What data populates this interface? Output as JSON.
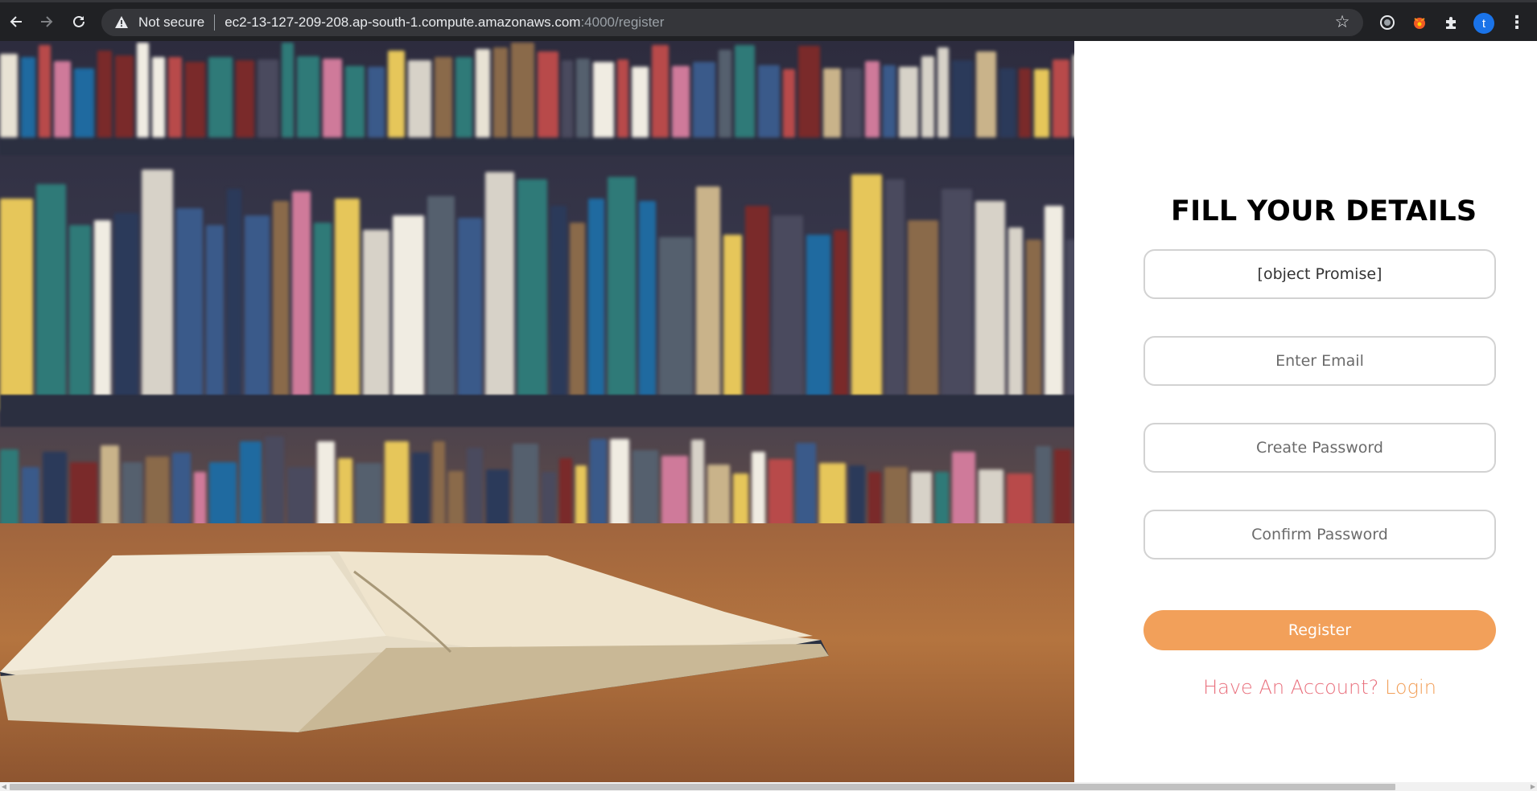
{
  "browser": {
    "security_label": "Not secure",
    "url_host": "ec2-13-127-209-208.ap-south-1.compute.amazonaws.com",
    "url_path": ":4000/register",
    "profile_initial": "t",
    "icons": [
      "back-icon",
      "forward-icon",
      "reload-icon",
      "warning-icon",
      "star-icon",
      "extension-circle-icon",
      "extension-fox-icon",
      "puzzle-icon",
      "kebab-menu-icon"
    ]
  },
  "form": {
    "title": "FILL YOUR DETAILS",
    "name_value": "[object Promise]",
    "email_placeholder": "Enter Email",
    "password_placeholder": "Create Password",
    "confirm_placeholder": "Confirm Password",
    "submit_label": "Register",
    "account_prompt": "Have An Account?",
    "login_link": "Login"
  },
  "colors": {
    "button": "#f2a05a",
    "prompt": "#e9707d",
    "link": "#f2a05a"
  }
}
